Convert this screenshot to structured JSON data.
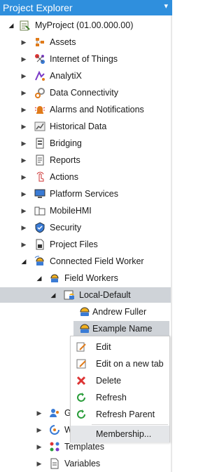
{
  "panel": {
    "title": "Project Explorer",
    "pin_glyph": "▾"
  },
  "tree": {
    "root": "MyProject (01.00.000.00)",
    "items": [
      "Assets",
      "Internet of Things",
      "AnalytiX",
      "Data Connectivity",
      "Alarms and Notifications",
      "Historical Data",
      "Bridging",
      "Reports",
      "Actions",
      "Platform Services",
      "MobileHMI",
      "Security",
      "Project Files",
      "Connected Field Worker"
    ],
    "field_workers": "Field Workers",
    "local_default": "Local-Default",
    "workers": [
      "Andrew Fuller",
      "Example Name"
    ],
    "partial_items": [
      "G",
      "W"
    ],
    "templates": "Templates",
    "variables": "Variables"
  },
  "context_menu": {
    "items": [
      "Edit",
      "Edit on a new tab",
      "Delete",
      "Refresh",
      "Refresh Parent",
      "Membership..."
    ]
  },
  "colors": {
    "accent": "#2f8fdd",
    "selection": "#cfd3d8"
  }
}
